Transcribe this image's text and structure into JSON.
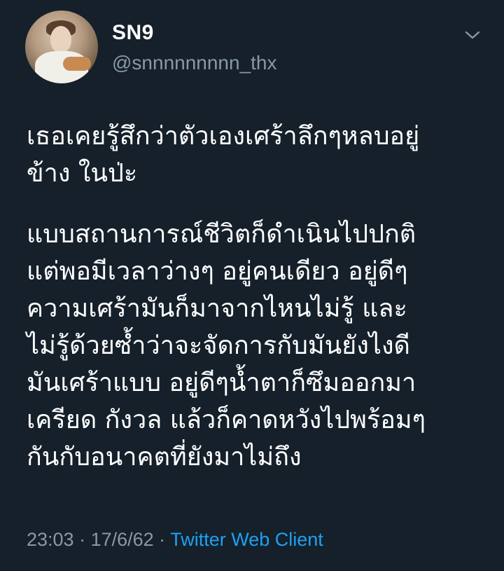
{
  "user": {
    "display_name": "SN9",
    "handle": "@snnnnnnnnn_thx",
    "avatar_icon": "profile-photo"
  },
  "menu_icon": "chevron-down-icon",
  "tweet": {
    "paragraph1": [
      "เธอเคยรู้สึกว่าตัวเองเศร้าลึกๆหลบอยู่",
      "ข้าง ในป่ะ"
    ],
    "paragraph2": [
      "แบบสถานการณ์ชีวิตก็ดำเนินไปปกติ",
      "แต่พอมีเวลาว่างๆ อยู่คนเดียว อยู่ดีๆ",
      "ความเศร้ามันก็มาจากไหนไม่รู้ และ",
      "ไม่รู้ด้วยซ้ำว่าจะจัดการกับมันยังไงดี",
      "มันเศร้าแบบ อยู่ดีๆน้ำตาก็ซึมออกมา",
      "เครียด กังวล แล้วก็คาดหวังไปพร้อมๆ",
      "กันกับอนาคตที่ยังมาไม่ถึง"
    ]
  },
  "meta": {
    "time": "23:03",
    "sep1": " · ",
    "date": "17/6/62",
    "sep2": " · ",
    "source": "Twitter Web Client"
  },
  "colors": {
    "background": "#15202b",
    "text": "#ffffff",
    "secondary": "#8899a6",
    "link": "#1da1f2"
  }
}
